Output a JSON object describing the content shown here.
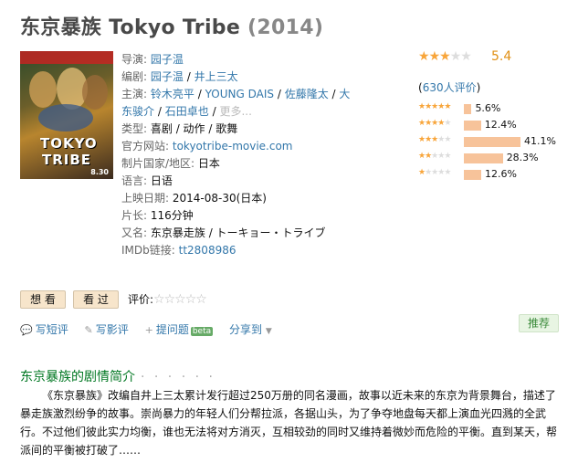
{
  "title": "东京暴族 Tokyo Tribe",
  "year": "(2014)",
  "poster": {
    "title_line1": "TOKYO",
    "title_line2": "TRIBE",
    "date": "8.30"
  },
  "info": {
    "director_label": "导演:",
    "director": "园子温",
    "writer_label": "编剧:",
    "writers": [
      "园子温",
      "井上三太"
    ],
    "cast_label": "主演:",
    "cast_line1": [
      "铃木亮平",
      "YOUNG DAIS",
      "佐藤隆太",
      "大"
    ],
    "cast_line2": [
      "东骏介",
      "石田卓也",
      "更多..."
    ],
    "genre_label": "类型:",
    "genres": "喜剧 / 动作 / 歌舞",
    "site_label": "官方网站:",
    "site": "tokyotribe-movie.com",
    "country_label": "制片国家/地区:",
    "country": "日本",
    "language_label": "语言:",
    "language": "日语",
    "release_label": "上映日期:",
    "release": "2014-08-30(日本)",
    "runtime_label": "片长:",
    "runtime": "116分钟",
    "aka_label": "又名:",
    "aka": "东京暴走族 / トーキョー・トライブ",
    "imdb_label": "IMDb链接:",
    "imdb": "tt2808986"
  },
  "rating": {
    "score": "5.4",
    "stars": 3,
    "votes_prefix": "(",
    "votes_link": "630人评价",
    "votes_suffix": ")",
    "distribution": [
      {
        "stars": 5,
        "pct": "5.6%",
        "value": 5.6
      },
      {
        "stars": 4,
        "pct": "12.4%",
        "value": 12.4
      },
      {
        "stars": 3,
        "pct": "41.1%",
        "value": 41.1
      },
      {
        "stars": 2,
        "pct": "28.3%",
        "value": 28.3
      },
      {
        "stars": 1,
        "pct": "12.6%",
        "value": 12.6
      }
    ]
  },
  "buttons": {
    "want": "想 看",
    "seen": "看 过",
    "rate_label": "评价:"
  },
  "actions": {
    "short_review": "写短评",
    "review": "写影评",
    "question": "提问题",
    "beta": "beta",
    "share": "分享到",
    "recommend": "推荐"
  },
  "synopsis": {
    "title": "东京暴族的剧情简介",
    "dots": "· · · · · ·",
    "text": "《东京暴族》改编自井上三太累计发行超过250万册的同名漫画，故事以近未来的东京为背景舞台，描述了暴走族激烈纷争的故事。崇尚暴力的年轻人们分帮拉派，各据山头，为了争夺地盘每天都上演血光四溅的全武行。不过他们彼此实力均衡，谁也无法将对方消灭，互相较劲的同时又维持着微妙而危险的平衡。直到某天，帮派间的平衡被打破了……"
  },
  "colors": {
    "link": "#3377aa",
    "star": "#f8a53a",
    "score": "#e09015",
    "bar": "#f7c39a",
    "section": "#007722"
  }
}
